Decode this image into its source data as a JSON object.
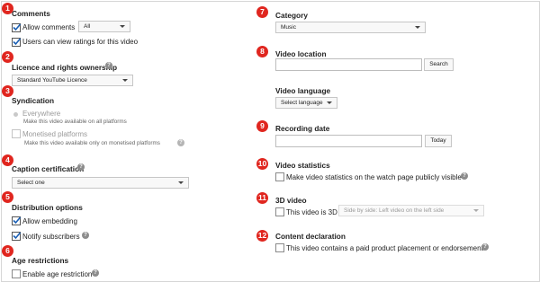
{
  "badges": [
    "1",
    "2",
    "3",
    "4",
    "5",
    "6",
    "7",
    "8",
    "9",
    "10",
    "11",
    "12"
  ],
  "comments": {
    "title": "Comments",
    "allow_label": "Allow comments",
    "allow_select": "All",
    "ratings_label": "Users can view ratings for this video"
  },
  "licence": {
    "title": "Licence and rights ownership",
    "select": "Standard YouTube Licence"
  },
  "syndication": {
    "title": "Syndication",
    "everywhere_label": "Everywhere",
    "everywhere_desc": "Make this video available on all platforms",
    "monetised_label": "Monetised platforms",
    "monetised_desc": "Make this video available only on monetised platforms"
  },
  "caption": {
    "title": "Caption certification",
    "select": "Select one"
  },
  "distribution": {
    "title": "Distribution options",
    "embedding_label": "Allow embedding",
    "notify_label": "Notify subscribers"
  },
  "age": {
    "title": "Age restrictions",
    "enable_label": "Enable age restriction"
  },
  "category": {
    "title": "Category",
    "select": "Music"
  },
  "location": {
    "title": "Video location",
    "value": "",
    "search_button": "Search"
  },
  "language": {
    "title": "Video language",
    "select": "Select language"
  },
  "recording": {
    "title": "Recording date",
    "value": "",
    "today_button": "Today"
  },
  "statistics": {
    "title": "Video statistics",
    "label": "Make video statistics on the watch page publicly visible"
  },
  "video3d": {
    "title": "3D video",
    "label": "This video is 3D",
    "select": "Side by side: Left video on the left side"
  },
  "content": {
    "title": "Content declaration",
    "label": "This video contains a paid product placement or endorsement"
  },
  "icons": {
    "help": "?",
    "check": "checkmark-icon",
    "caret": "caret-down-icon"
  },
  "colors": {
    "badge": "#e0261f",
    "help_icon": "#8c8c8c"
  }
}
